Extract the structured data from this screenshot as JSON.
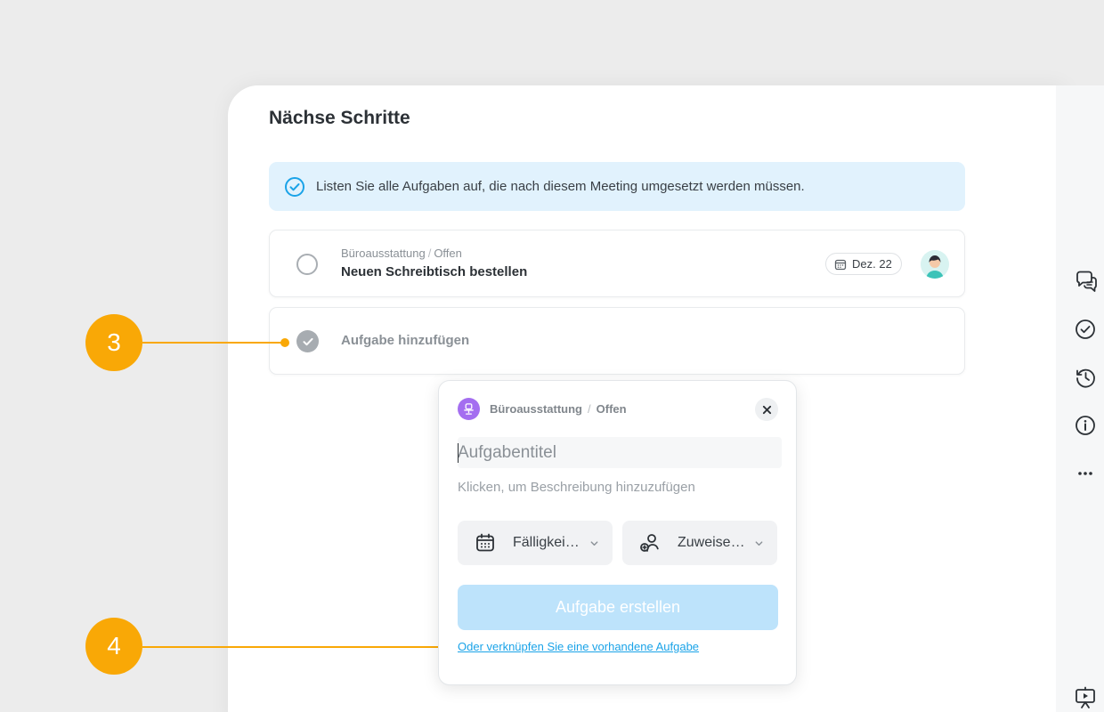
{
  "page": {
    "title": "Nächse Schritte"
  },
  "banner": {
    "text": "Listen Sie alle Aufgaben auf, die nach diesem Meeting umgesetzt werden müssen.",
    "icon": "check-circle-icon"
  },
  "task": {
    "category": "Büroausstattung",
    "status": "Offen",
    "separator": "/",
    "title": "Neuen Schreibtisch bestellen",
    "due_date": "Dez. 22"
  },
  "add_task": {
    "label": "Aufgabe hinzufügen"
  },
  "callouts": [
    {
      "number": "3"
    },
    {
      "number": "4"
    }
  ],
  "popover": {
    "category": "Büroausstattung",
    "separator": "/",
    "status": "Offen",
    "title_placeholder": "Aufgabentitel",
    "description_placeholder": "Klicken, um Beschreibung hinzuzufügen",
    "due_label": "Fälligkei…",
    "assign_label": "Zuweise…",
    "create_button": "Aufgabe erstellen",
    "link_existing": "Oder verknüpfen Sie eine vorhandene Aufgabe"
  },
  "rail": {
    "icons": [
      "comments-icon",
      "check-circle-icon",
      "history-icon",
      "info-icon",
      "more-icon",
      "presentation-icon"
    ]
  },
  "colors": {
    "accent": "#1aa3e8",
    "callout": "#f9a806",
    "banner_bg": "#e1f2fd",
    "category": "#a46ef0"
  }
}
